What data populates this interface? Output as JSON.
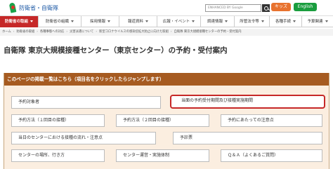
{
  "header": {
    "logo_text": "防衛省・自衛隊",
    "search_placeholder": "ENHANCED BY Google",
    "kids_button": "キッズ",
    "english_button": "English"
  },
  "nav": {
    "items": [
      {
        "label": "防衛省の取組",
        "active": true
      },
      {
        "label": "防衛省の組織"
      },
      {
        "label": "採用情報"
      },
      {
        "label": "報道資料"
      },
      {
        "label": "広報・イベント"
      },
      {
        "label": "調達情報"
      },
      {
        "label": "所管法令等"
      },
      {
        "label": "各種手続"
      },
      {
        "label": "予算関連"
      }
    ]
  },
  "breadcrumb": [
    "ホーム",
    "防衛省の取組",
    "各種事態への対応",
    "災害派遣について",
    "新型コロナウイルスの感染症拡大防止に向けた取組",
    "自衛隊 東京大規模接種センターの予約・受付案内"
  ],
  "page_title": "自衛隊 東京大規模接種センター（東京センター）の予約・受付案内",
  "toc": {
    "heading": "このページの掲載一覧はこちら（項目名をクリックしたらジャンプします）",
    "items": [
      {
        "label": "予約対象者"
      },
      {
        "label": "当面の予約受付期間及び接種実施期間",
        "highlighted": true
      },
      {
        "label": "予約方法（１回目の接種）"
      },
      {
        "label": "予約方法（２回目の接種）"
      },
      {
        "label": "予約にあたっての注意点"
      },
      {
        "label": "当日のセンターにおける接種の流れ・注意点"
      },
      {
        "label": "予診票"
      },
      {
        "label": "センターの場所、行き方"
      },
      {
        "label": "センター運営・実施体制"
      },
      {
        "label": "Ｑ＆Ａ（よくあるご質問）"
      }
    ]
  },
  "colors": {
    "nav_active": "#c62828",
    "toc_header": "#a65b21",
    "toc_background": "#fbeee0",
    "highlight_border": "#c62828",
    "kids_button": "#e8722e",
    "english_button": "#1a9d3e",
    "logo_text": "#1e5aa6"
  }
}
